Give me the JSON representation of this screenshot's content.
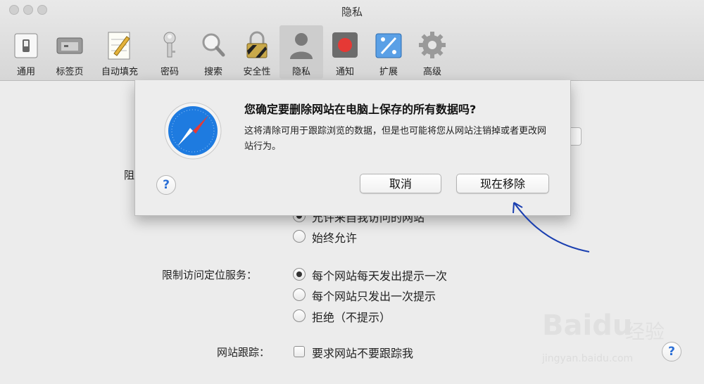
{
  "window": {
    "title": "隐私"
  },
  "toolbar": {
    "items": [
      {
        "label": "通用",
        "icon": "general-switch-icon"
      },
      {
        "label": "标签页",
        "icon": "tabs-icon"
      },
      {
        "label": "自动填充",
        "icon": "autofill-pencil-icon"
      },
      {
        "label": "密码",
        "icon": "key-icon"
      },
      {
        "label": "搜索",
        "icon": "magnifier-icon"
      },
      {
        "label": "安全性",
        "icon": "padlock-icon"
      },
      {
        "label": "隐私",
        "icon": "person-silhouette-icon",
        "active": true
      },
      {
        "label": "通知",
        "icon": "record-icon"
      },
      {
        "label": "扩展",
        "icon": "puzzle-icon"
      },
      {
        "label": "高级",
        "icon": "gear-icon"
      }
    ]
  },
  "prefs": {
    "cookies_label_partial": "阻",
    "cookie_partial_option": "允许来自我访问的网站",
    "cookie_always_allow": "始终允许",
    "location_label": "限制访问定位服务：",
    "location_options": [
      "每个网站每天发出提示一次",
      "每个网站只发出一次提示",
      "拒绝（不提示）"
    ],
    "tracking_label": "网站跟踪：",
    "tracking_option": "要求网站不要跟踪我"
  },
  "dialog": {
    "title": "您确定要删除网站在电脑上保存的所有数据吗?",
    "message": "这将清除可用于跟踪浏览的数据，但是也可能将您从网站注销掉或者更改网站行为。",
    "cancel_label": "取消",
    "confirm_label": "现在移除",
    "help_label": "?"
  },
  "help_label": "?",
  "watermark": {
    "brand": "Baidu",
    "brand_suffix": "经验",
    "url": "jingyan.baidu.com"
  },
  "colors": {
    "arrow": "#1a3fb0",
    "safari_blue": "#1e7be0"
  }
}
